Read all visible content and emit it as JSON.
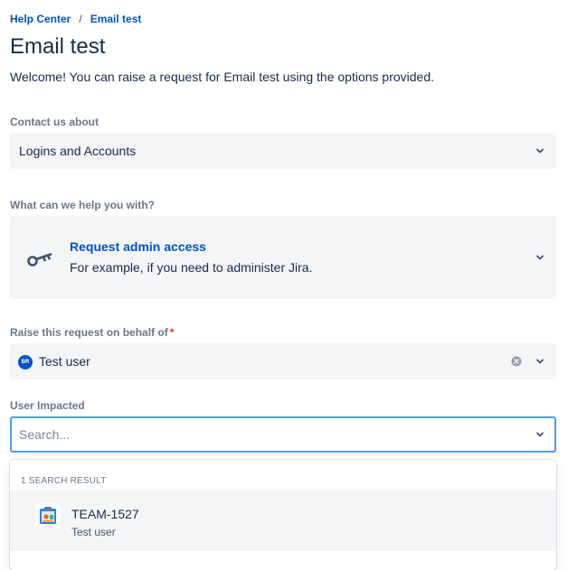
{
  "breadcrumb": {
    "home": "Help Center",
    "separator": "/",
    "current": "Email test"
  },
  "page": {
    "title": "Email test",
    "welcome": "Welcome! You can raise a request for Email test using the options provided."
  },
  "contact": {
    "label": "Contact us about",
    "value": "Logins and Accounts"
  },
  "help": {
    "label": "What can we help you with?",
    "title": "Request admin access",
    "description": "For example, if you need to administer Jira.",
    "icon": "key-icon"
  },
  "behalf": {
    "label": "Raise this request on behalf of",
    "required_mark": "*",
    "avatar_initials": "BR",
    "value": "Test user"
  },
  "user_impacted": {
    "label": "User Impacted",
    "placeholder": "Search..."
  },
  "results": {
    "header": "1 SEARCH RESULT",
    "items": [
      {
        "title": "TEAM-1527",
        "subtitle": "Test user"
      }
    ]
  },
  "colors": {
    "link": "#0052cc",
    "focus": "#4c9aff",
    "field_bg": "#f4f5f7",
    "required": "#de350b"
  }
}
